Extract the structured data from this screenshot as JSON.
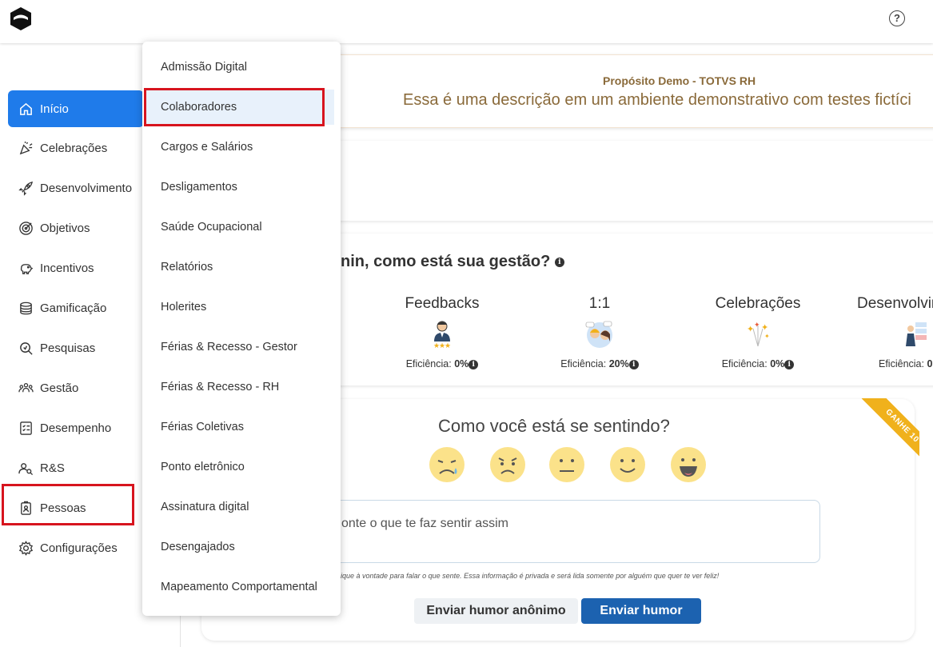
{
  "header": {
    "help_label": "?"
  },
  "sidebar": {
    "items": [
      {
        "label": "Início",
        "icon": "home-icon"
      },
      {
        "label": "Celebrações",
        "icon": "party-popper-icon"
      },
      {
        "label": "Desenvolvimento",
        "icon": "rocket-icon"
      },
      {
        "label": "Objetivos",
        "icon": "target-icon"
      },
      {
        "label": "Incentivos",
        "icon": "piggy-bank-icon"
      },
      {
        "label": "Gamificação",
        "icon": "coins-icon"
      },
      {
        "label": "Pesquisas",
        "icon": "search-icon"
      },
      {
        "label": "Gestão",
        "icon": "team-icon"
      },
      {
        "label": "Desempenho",
        "icon": "checklist-icon"
      },
      {
        "label": "R&S",
        "icon": "people-search-icon"
      },
      {
        "label": "Pessoas",
        "icon": "id-badge-icon"
      },
      {
        "label": "Configurações",
        "icon": "gear-icon"
      }
    ]
  },
  "dropdown": {
    "items": [
      "Admissão Digital",
      "Colaboradores",
      "Cargos e Salários",
      "Desligamentos",
      "Saúde Ocupacional",
      "Relatórios",
      "Holerites",
      "Férias & Recesso - Gestor",
      "Férias & Recesso - RH",
      "Férias Coletivas",
      "Ponto eletrônico",
      "Assinatura digital",
      "Desengajados",
      "Mapeamento Comportamental"
    ]
  },
  "purpose": {
    "title": "Propósito Demo - TOTVS RH",
    "description": "Essa é uma descrição em um ambiente demonstrativo com testes fictíci"
  },
  "management": {
    "title_partial": "nin",
    "title_rest": ", como está sua gestão?",
    "metrics": [
      {
        "name": "Feedbacks",
        "efficiency_label": "Eficiência:",
        "efficiency_value": "0%"
      },
      {
        "name": "1:1",
        "efficiency_label": "Eficiência:",
        "efficiency_value": "20%"
      },
      {
        "name": "Celebrações",
        "efficiency_label": "Eficiência:",
        "efficiency_value": "0%"
      },
      {
        "name": "Desenvolvir",
        "efficiency_label": "Eficiência:",
        "efficiency_value": "0"
      }
    ]
  },
  "mood": {
    "title": "Como você está se sentindo?",
    "input_placeholder": "onte o que te faz sentir assim",
    "note": "ique à vontade para falar o que sente. Essa informação é privada e será lida somente por alguém que quer te ver feliz!",
    "anon_button": "Enviar humor anônimo",
    "send_button": "Enviar humor",
    "ribbon": "GANHE 10"
  },
  "colors": {
    "accent": "#1f7bea",
    "highlight_box": "#d7141e",
    "send_button": "#1c62b0",
    "purpose_text": "#8a6a3a",
    "ribbon": "#f0b11c",
    "face": "#fbe28a"
  }
}
